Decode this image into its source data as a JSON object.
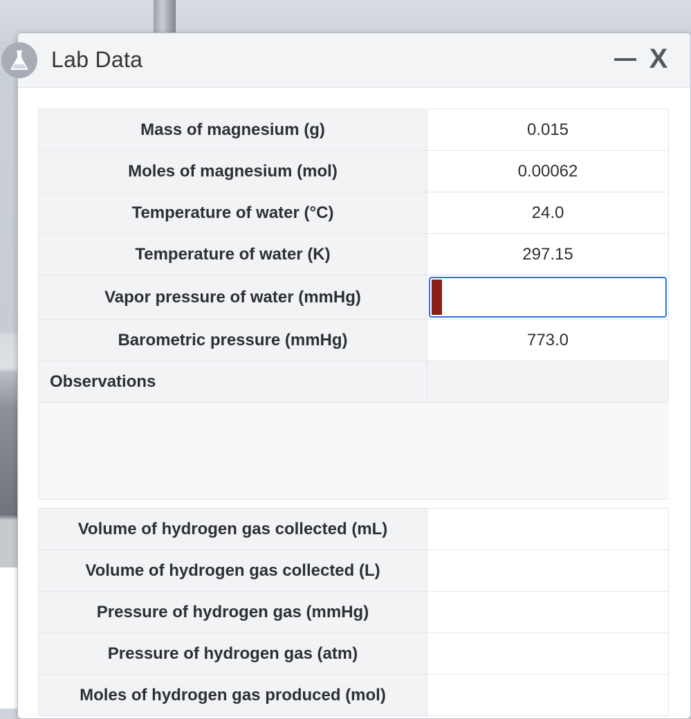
{
  "window": {
    "title": "Lab Data",
    "icon": "flask-icon",
    "minimize_icon": "minimize-icon",
    "close_label": "X"
  },
  "table": {
    "rows": [
      {
        "label": "Mass of magnesium (g)",
        "value": "0.015"
      },
      {
        "label": "Moles of magnesium (mol)",
        "value": "0.00062"
      },
      {
        "label": "Temperature of water (°C)",
        "value": "24.0"
      },
      {
        "label": "Temperature of water (K)",
        "value": "297.15"
      },
      {
        "label": "Vapor pressure of water (mmHg)",
        "value": ""
      },
      {
        "label": "Barometric pressure (mmHg)",
        "value": "773.0"
      }
    ],
    "observations_label": "Observations",
    "observations_text": "",
    "lower_rows": [
      {
        "label": "Volume of hydrogen gas collected (mL)",
        "value": ""
      },
      {
        "label": "Volume of hydrogen gas collected (L)",
        "value": ""
      },
      {
        "label": "Pressure of hydrogen gas (mmHg)",
        "value": ""
      },
      {
        "label": "Pressure of hydrogen gas (atm)",
        "value": ""
      },
      {
        "label": "Moles of hydrogen gas produced (mol)",
        "value": ""
      }
    ]
  },
  "colors": {
    "focus_border": "#2f6fe0",
    "required_flag": "#8b1f15"
  }
}
